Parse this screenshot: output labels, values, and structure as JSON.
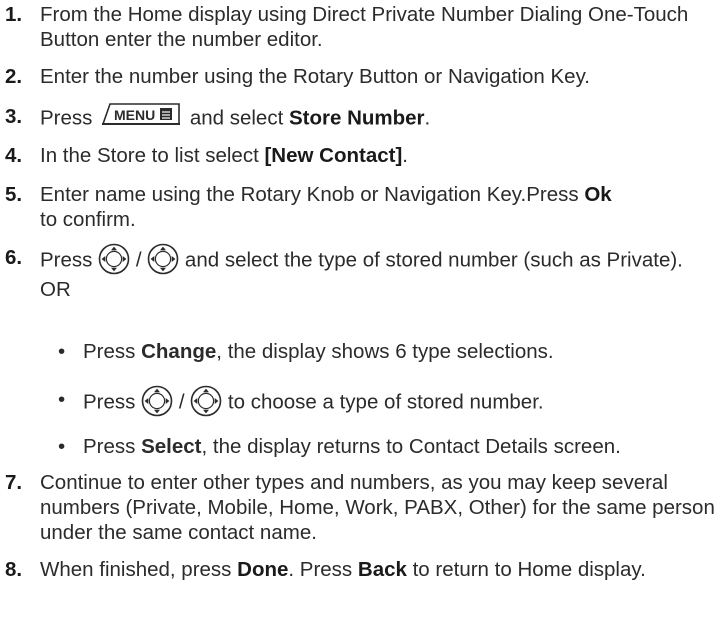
{
  "steps": [
    {
      "n": "1.",
      "text": "From the Home display using Direct Private Number Dialing One-Touch Button enter the number editor."
    },
    {
      "n": "2.",
      "text": "Enter the number using the Rotary Button or Navigation Key."
    },
    {
      "n": "3.",
      "pre": "Press",
      "key": "MENU",
      "mid": "and select",
      "bold": "Store Number",
      "post": "."
    },
    {
      "n": "4.",
      "pre": "In the Store to list select",
      "bold": "[New Contact]",
      "post": "."
    },
    {
      "n": "5.",
      "pre": "Enter name using the Rotary Knob or Navigation Key.Press",
      "bold": "Ok",
      "post": "to confirm."
    },
    {
      "n": "6.",
      "pre": "Press",
      "sep": "/",
      "post": "and select the type of stored number (such as Private).",
      "or": "OR"
    },
    {
      "n": "7.",
      "text": "Continue to enter other types and numbers, as you may keep several numbers (Private, Mobile, Home, Work, PABX, Other) for the same person under the same contact name."
    },
    {
      "n": "8.",
      "pre": "When finished, press",
      "bold": "Done",
      "mid": ". Press",
      "bold2": "Back",
      "post": "to return to Home display."
    }
  ],
  "bullets": [
    {
      "dot": "•",
      "pre": "Press",
      "bold": "Change",
      "post": ", the display shows 6 type selections."
    },
    {
      "dot": "•",
      "pre": "Press",
      "sep": "/",
      "post": "to choose a type of stored number."
    },
    {
      "dot": "•",
      "pre": "Press",
      "bold": "Select",
      "post": ", the display returns to Contact Details screen."
    }
  ],
  "icons": {
    "menu_key": "menu-key-icon",
    "nav_key": "navigation-key-icon"
  }
}
